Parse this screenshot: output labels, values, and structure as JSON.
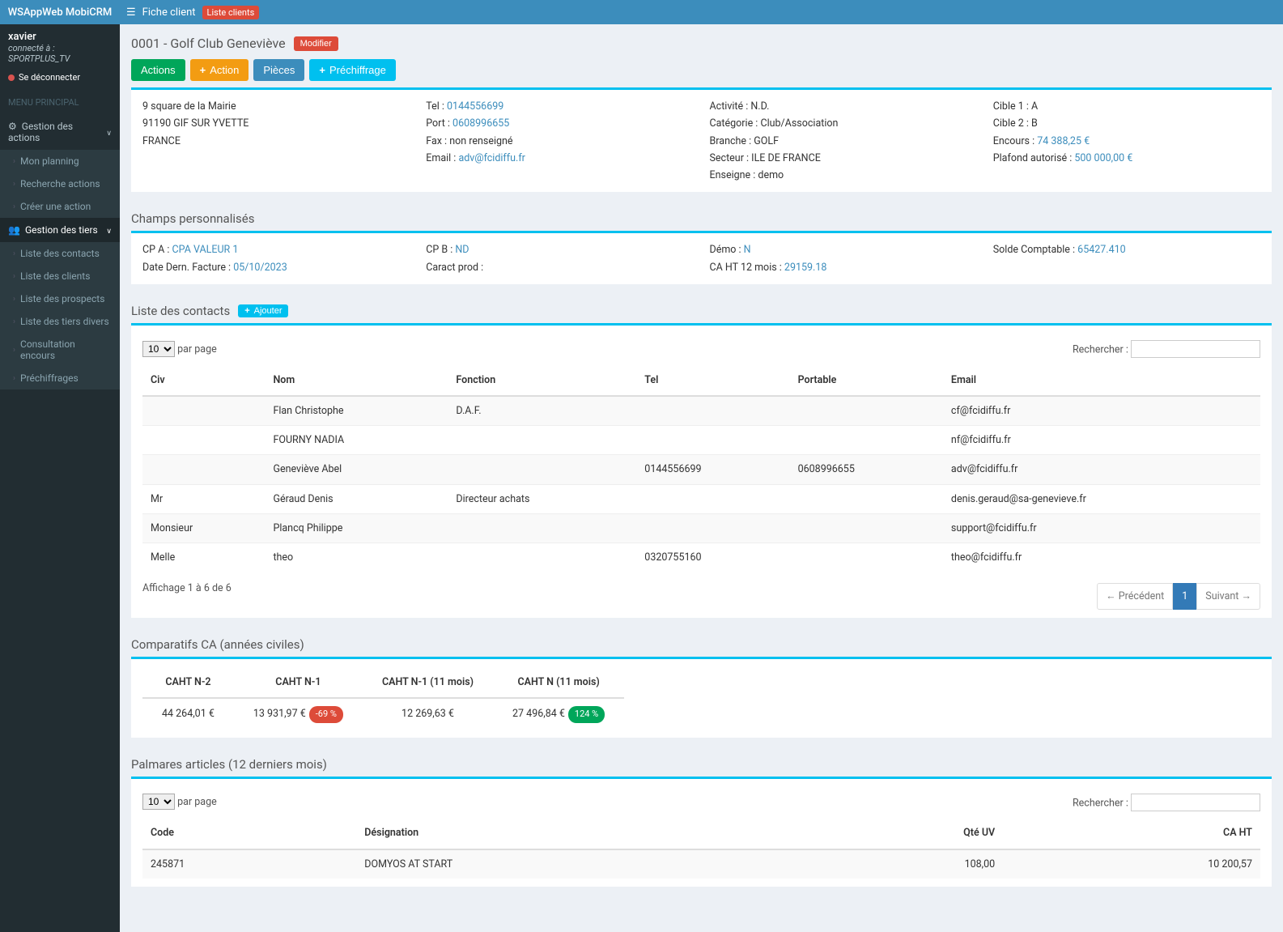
{
  "brand": "WSAppWeb MobiCRM",
  "breadcrumb": {
    "label": "Fiche client",
    "badge": "Liste clients"
  },
  "user": {
    "name": "xavier",
    "connected_prefix": "connecté à : ",
    "db": "SPORTPLUS_TV",
    "logout": "Se déconnecter"
  },
  "menu": {
    "header": "MENU PRINCIPAL",
    "groups": [
      {
        "label": "Gestion des actions",
        "icon": "gear",
        "open": true,
        "items": [
          {
            "label": "Mon planning"
          },
          {
            "label": "Recherche actions"
          },
          {
            "label": "Créer une action"
          }
        ]
      },
      {
        "label": "Gestion des tiers",
        "icon": "users",
        "open": true,
        "active": true,
        "items": [
          {
            "label": "Liste des contacts"
          },
          {
            "label": "Liste des clients"
          },
          {
            "label": "Liste des prospects"
          },
          {
            "label": "Liste des tiers divers"
          },
          {
            "label": "Consultation encours"
          },
          {
            "label": "Préchiffrages"
          }
        ]
      }
    ]
  },
  "page": {
    "title_code": "0001 - Golf Club Geneviève",
    "modify": "Modifier",
    "toolbar": {
      "actions": "Actions",
      "action": "Action",
      "pieces": "Pièces",
      "prechiff": "Préchiffrage"
    }
  },
  "info": {
    "col1": {
      "l1": "9 square de la Mairie",
      "l2": "91190 GIF SUR YVETTE",
      "l3": "FRANCE"
    },
    "col2": {
      "tel_l": "Tel : ",
      "tel": "0144556699",
      "port_l": "Port : ",
      "port": "0608996655",
      "fax_l": "Fax : ",
      "fax": "non renseigné",
      "email_l": "Email : ",
      "email": "adv@fcidiffu.fr"
    },
    "col3": {
      "act_l": "Activité : ",
      "act": "N.D.",
      "cat_l": "Catégorie : ",
      "cat": "Club/Association",
      "bra_l": "Branche : ",
      "bra": "GOLF",
      "sec_l": "Secteur : ",
      "sec": "ILE DE FRANCE",
      "ens_l": "Enseigne : ",
      "ens": "demo"
    },
    "col4": {
      "c1_l": "Cible 1 : ",
      "c1": "A",
      "c2_l": "Cible 2 : ",
      "c2": "B",
      "enc_l": "Encours : ",
      "enc": "74 388,25 €",
      "pla_l": "Plafond autorisé : ",
      "pla": "500 000,00 €"
    }
  },
  "custom": {
    "title": "Champs personnalisés",
    "col1": {
      "cpa_l": "CP A : ",
      "cpa": "CPA VALEUR 1",
      "date_l": "Date Dern. Facture : ",
      "date": "05/10/2023"
    },
    "col2": {
      "cpb_l": "CP B : ",
      "cpb": "ND",
      "cprod_l": "Caract prod :",
      "cprod": ""
    },
    "col3": {
      "demo_l": "Démo : ",
      "demo": "N",
      "ca_l": "CA HT 12 mois : ",
      "ca": "29159.18"
    },
    "col4": {
      "solde_l": "Solde Comptable : ",
      "solde": "65427.410"
    }
  },
  "contacts": {
    "title": "Liste des contacts",
    "add": "Ajouter",
    "perpage_suffix": "par page",
    "perpage_value": "10",
    "search_l": "Rechercher :",
    "headers": [
      "Civ",
      "Nom",
      "Fonction",
      "Tel",
      "Portable",
      "Email"
    ],
    "rows": [
      [
        "",
        "Flan Christophe",
        "D.A.F.",
        "",
        "",
        "cf@fcidiffu.fr"
      ],
      [
        "",
        "FOURNY NADIA",
        "",
        "",
        "",
        "nf@fcidiffu.fr"
      ],
      [
        "",
        "Geneviève Abel",
        "",
        "0144556699",
        "0608996655",
        "adv@fcidiffu.fr"
      ],
      [
        "Mr",
        "Géraud Denis",
        "Directeur achats",
        "",
        "",
        "denis.geraud@sa-genevieve.fr"
      ],
      [
        "Monsieur",
        "Plancq Philippe",
        "",
        "",
        "",
        "support@fcidiffu.fr"
      ],
      [
        "Melle",
        "theo",
        "",
        "0320755160",
        "",
        "theo@fcidiffu.fr"
      ]
    ],
    "info": "Affichage 1 à 6 de 6",
    "pager": {
      "prev": "← Précédent",
      "1": "1",
      "next": "Suivant →"
    }
  },
  "comparatif": {
    "title": "Comparatifs CA (années civiles)",
    "headers": [
      "CAHT N-2",
      "CAHT N-1",
      "CAHT N-1 (11 mois)",
      "CAHT N (11 mois)"
    ],
    "row": [
      "44 264,01 €",
      "13 931,97 €",
      "12 269,63 €",
      "27 496,84 €"
    ],
    "pills": {
      "n1": "-69 %",
      "n": "124 %"
    }
  },
  "palmares": {
    "title": "Palmares articles (12 derniers mois)",
    "perpage_value": "10",
    "perpage_suffix": "par page",
    "search_l": "Rechercher :",
    "headers": [
      "Code",
      "Désignation",
      "Qté UV",
      "CA HT"
    ],
    "rows": [
      [
        "245871",
        "DOMYOS AT START",
        "108,00",
        "10 200,57"
      ]
    ]
  },
  "chart_data": {
    "type": "table",
    "title": "Comparatifs CA (années civiles)",
    "categories": [
      "CAHT N-2",
      "CAHT N-1",
      "CAHT N-1 (11 mois)",
      "CAHT N (11 mois)"
    ],
    "values": [
      44264.01,
      13931.97,
      12269.63,
      27496.84
    ],
    "annotations": {
      "CAHT N-1": "-69 %",
      "CAHT N (11 mois)": "124 %"
    },
    "unit": "€"
  }
}
